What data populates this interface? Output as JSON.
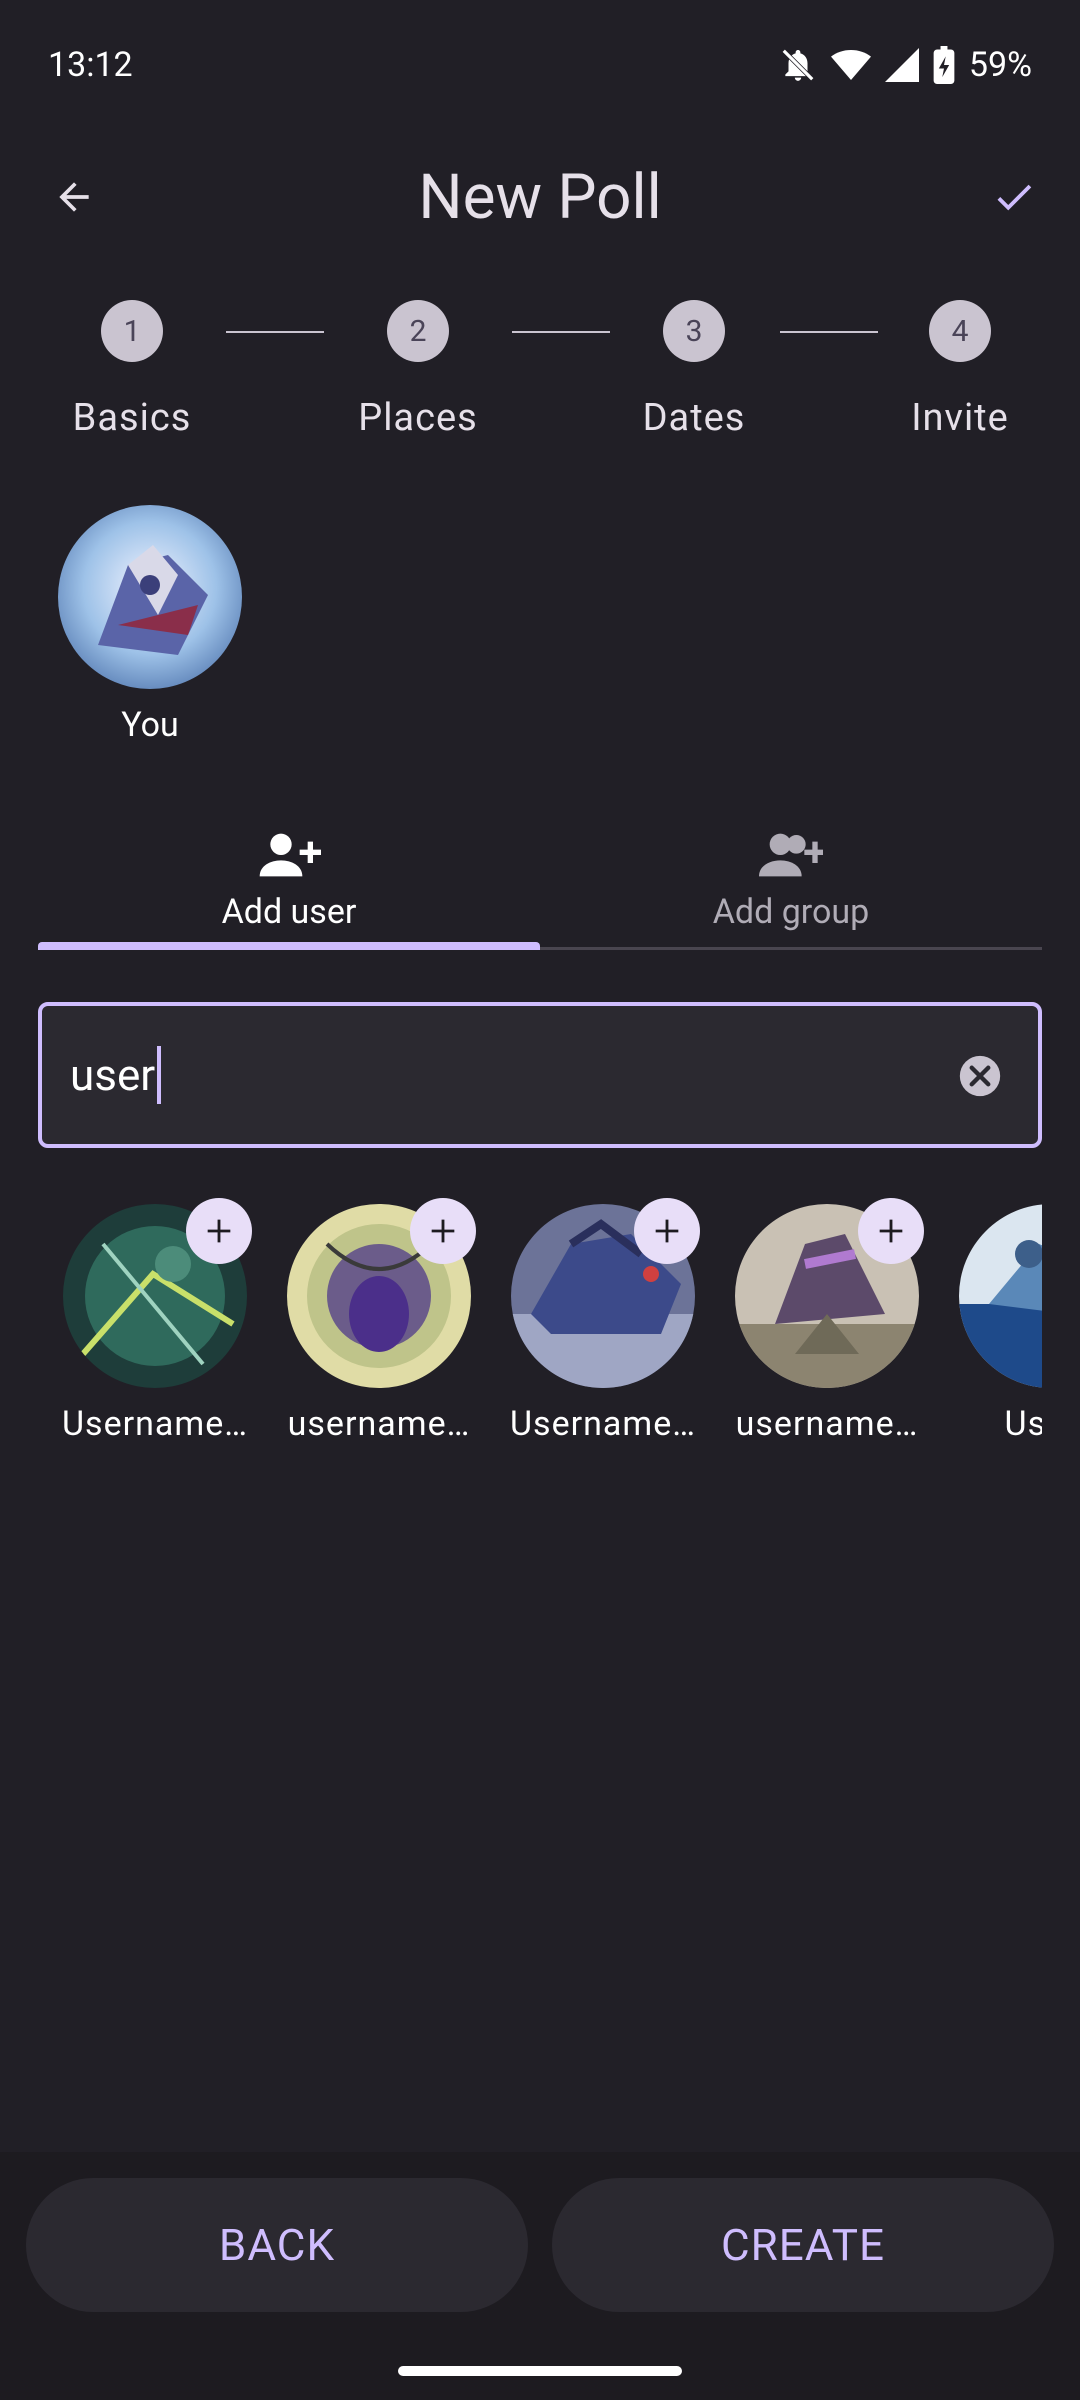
{
  "status_bar": {
    "time": "13:12",
    "battery": "59%",
    "icons": [
      "mute-icon",
      "wifi-icon",
      "signal-icon",
      "battery-charging-icon"
    ]
  },
  "app_bar": {
    "title": "New Poll",
    "back_icon": "arrow-back-icon",
    "confirm_icon": "check-icon"
  },
  "stepper": {
    "steps": [
      {
        "number": "1",
        "label": "Basics"
      },
      {
        "number": "2",
        "label": "Places"
      },
      {
        "number": "3",
        "label": "Dates"
      },
      {
        "number": "4",
        "label": "Invite"
      }
    ]
  },
  "participants": {
    "current_user_label": "You"
  },
  "tabs": {
    "items": [
      {
        "label": "Add user",
        "icon": "person-add-icon",
        "selected": true
      },
      {
        "label": "Add group",
        "icon": "group-add-icon",
        "selected": false
      }
    ]
  },
  "search": {
    "value": "user",
    "clear_icon": "clear-icon"
  },
  "results": {
    "items": [
      {
        "name": "Username…"
      },
      {
        "name": "username…"
      },
      {
        "name": "Username…"
      },
      {
        "name": "username…"
      },
      {
        "name": "Usern"
      }
    ]
  },
  "actions": {
    "back_label": "BACK",
    "create_label": "CREATE"
  },
  "colors": {
    "background": "#211f26",
    "accent": "#cfbdfe",
    "surface": "#2b2930",
    "step_circle": "#cac4d0"
  }
}
